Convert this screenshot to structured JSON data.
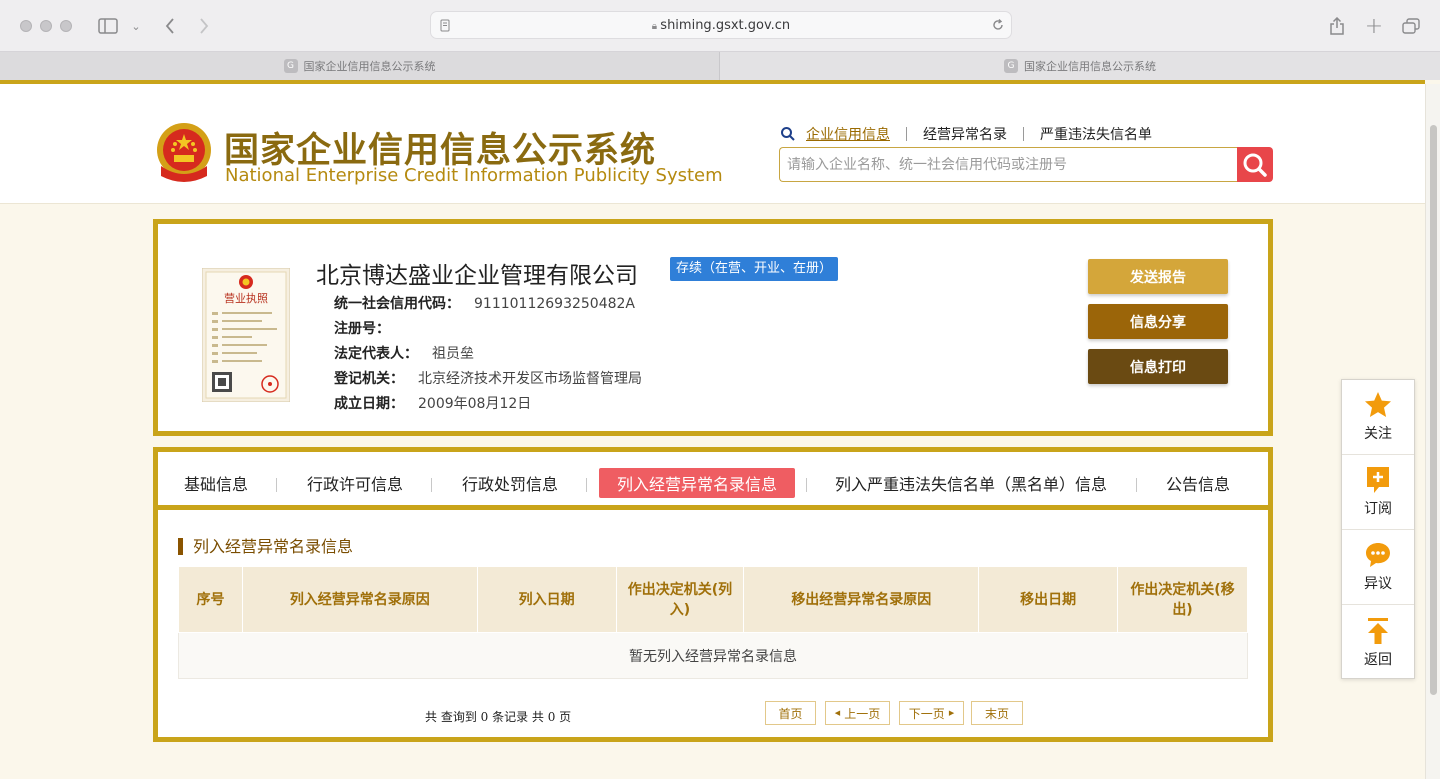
{
  "browser": {
    "url": "shiming.gsxt.gov.cn",
    "tabs": [
      {
        "title": "国家企业信用信息公示系统",
        "favicon": "G"
      },
      {
        "title": "国家企业信用信息公示系统",
        "favicon": "G"
      }
    ]
  },
  "header": {
    "title_cn": "国家企业信用信息公示系统",
    "title_en": "National Enterprise Credit Information Publicity System",
    "links": [
      "企业信用信息",
      "经营异常名录",
      "严重违法失信名单"
    ],
    "search_placeholder": "请输入企业名称、统一社会信用代码或注册号"
  },
  "company": {
    "name": "北京博达盛业企业管理有限公司",
    "status": "存续（在营、开业、在册）",
    "fields": [
      {
        "label": "统一社会信用代码：",
        "value": "91110112693250482A"
      },
      {
        "label": "注册号：",
        "value": ""
      },
      {
        "label": "法定代表人：",
        "value": "祖员垒"
      },
      {
        "label": "登记机关：",
        "value": "北京经济技术开发区市场监督管理局"
      },
      {
        "label": "成立日期：",
        "value": "2009年08月12日"
      }
    ],
    "license_title": "营业执照",
    "buttons": {
      "send": "发送报告",
      "share": "信息分享",
      "print": "信息打印"
    }
  },
  "tabs": {
    "items": [
      "基础信息",
      "行政许可信息",
      "行政处罚信息",
      "列入经营异常名录信息",
      "列入严重违法失信名单（黑名单）信息",
      "公告信息"
    ],
    "active_index": 3
  },
  "section": {
    "title": "列入经营异常名录信息",
    "columns": [
      "序号",
      "列入经营异常名录原因",
      "列入日期",
      "作出决定机关(列入)",
      "移出经营异常名录原因",
      "移出日期",
      "作出决定机关(移出)"
    ],
    "empty_text": "暂无列入经营异常名录信息",
    "count_text": "共 查询到 0 条记录 共 0 页",
    "pager": {
      "first": "首页",
      "prev": "上一页",
      "next": "下一页",
      "last": "末页"
    }
  },
  "sidebar": [
    {
      "label": "关注",
      "icon": "star-icon"
    },
    {
      "label": "订阅",
      "icon": "subscribe-icon"
    },
    {
      "label": "异议",
      "icon": "chat-bubble-icon"
    },
    {
      "label": "返回",
      "icon": "back-to-top-icon"
    }
  ],
  "colors": {
    "gold": "#c9a41a",
    "active_tab": "#ef5d62",
    "status": "#2f7fd8",
    "search_button": "#e8464a"
  }
}
